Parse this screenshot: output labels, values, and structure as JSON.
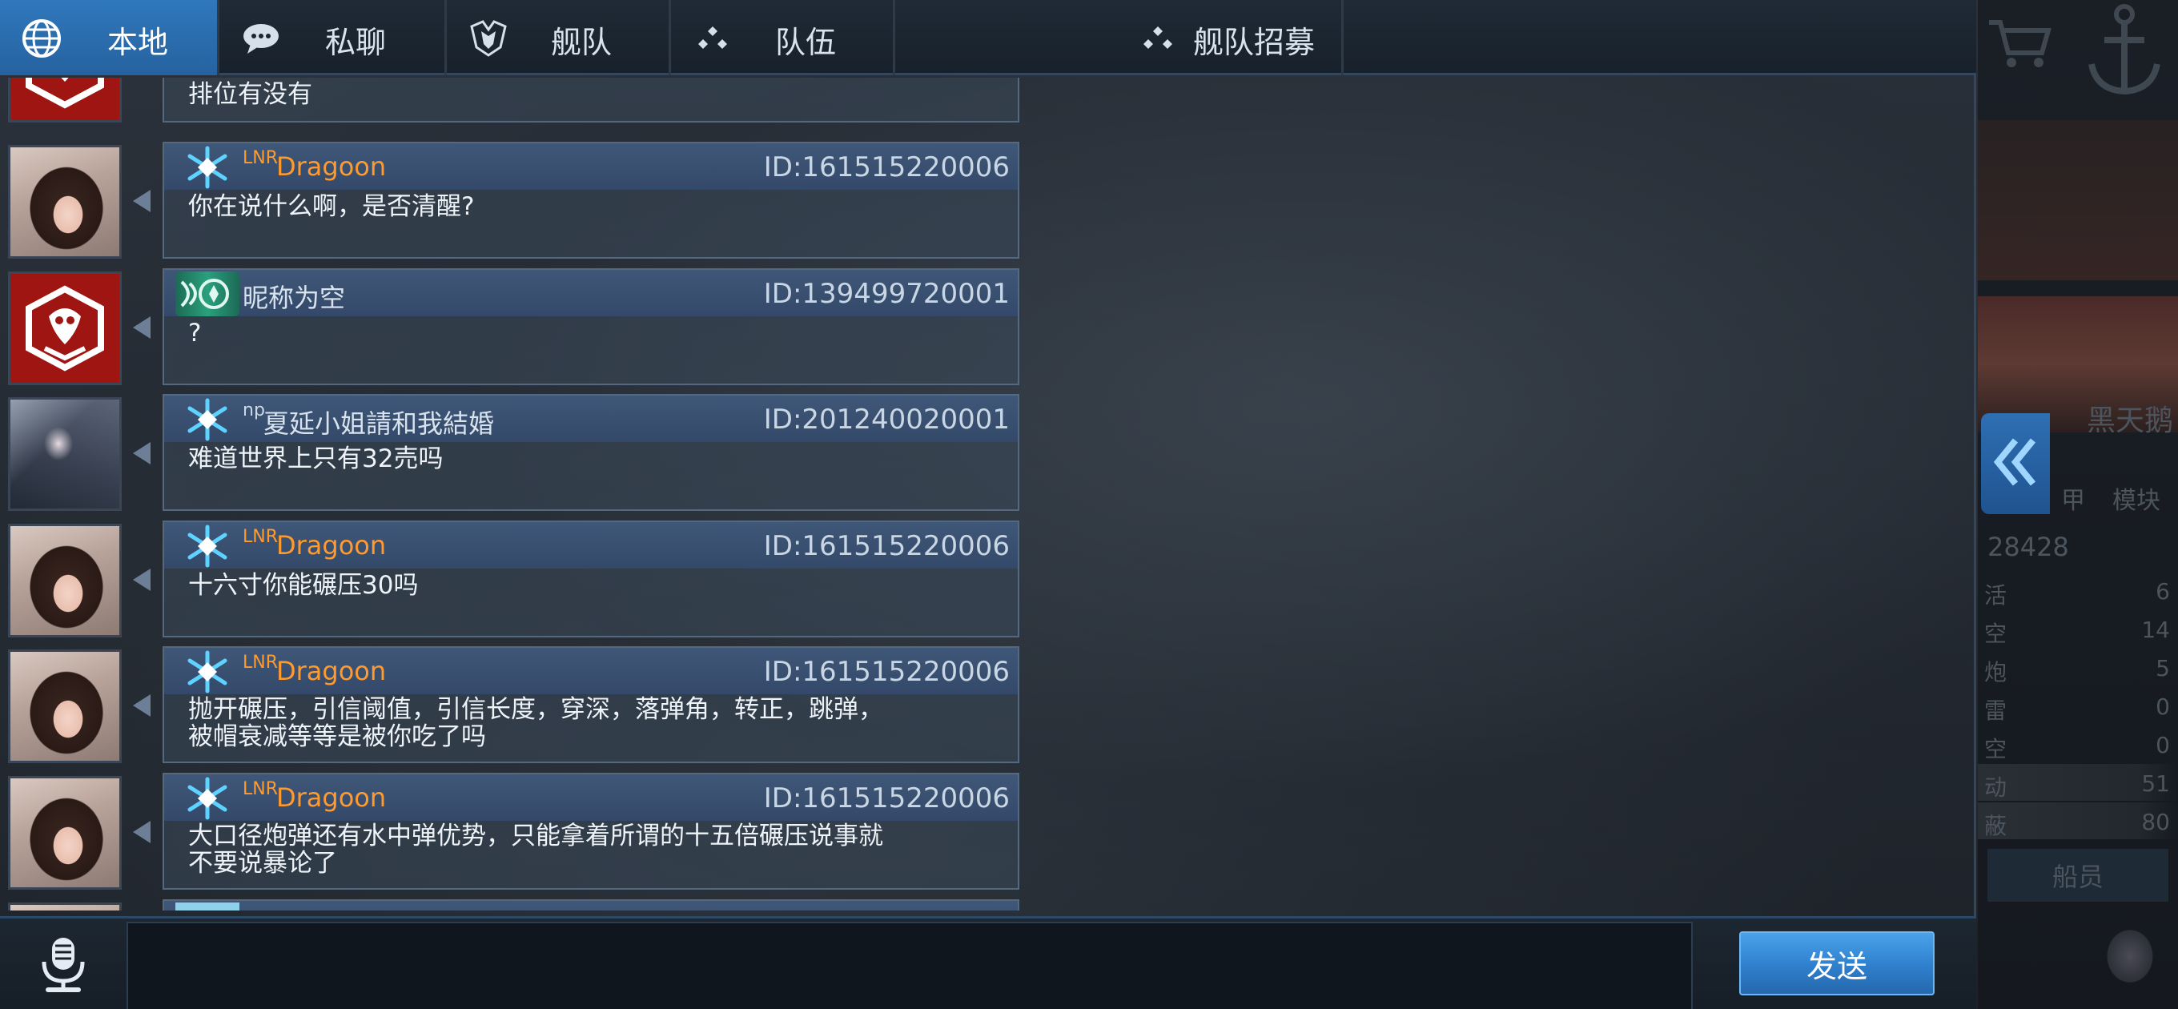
{
  "tabs": [
    {
      "label": "本地",
      "icon": "globe-icon",
      "active": true
    },
    {
      "label": "私聊",
      "icon": "chat-bubble-icon",
      "active": false
    },
    {
      "label": "舰队",
      "icon": "fleet-crest-icon",
      "active": false
    },
    {
      "label": "队伍",
      "icon": "team-dots-icon",
      "active": false
    },
    {
      "label": "舰队招募",
      "icon": "team-dots-icon",
      "active": false
    }
  ],
  "messages": [
    {
      "avatar": "red-emblem",
      "badge": "none",
      "prefix": "",
      "name": "",
      "id": "",
      "text": "排位有没有"
    },
    {
      "avatar": "girl",
      "badge": "blue-snowflake",
      "prefix": "LNR",
      "name": "Dragoon",
      "id": "ID:161515220006",
      "text": "你在说什么啊，是否清醒?"
    },
    {
      "avatar": "red-emblem",
      "badge": "green-dragon",
      "prefix": "",
      "name": "昵称为空",
      "id": "ID:139499720001",
      "text": "?"
    },
    {
      "avatar": "mecha",
      "badge": "blue-snowflake",
      "prefix": "np",
      "name": "夏延小姐請和我結婚",
      "id": "ID:201240020001",
      "text": "难道世界上只有32売吗"
    },
    {
      "avatar": "girl",
      "badge": "blue-snowflake",
      "prefix": "LNR",
      "name": "Dragoon",
      "id": "ID:161515220006",
      "text": "十六寸你能碾压30吗"
    },
    {
      "avatar": "girl",
      "badge": "blue-snowflake",
      "prefix": "LNR",
      "name": "Dragoon",
      "id": "ID:161515220006",
      "text": "抛开碾压，引信阈值，引信长度，穿深，落弹角，转正，跳弹，\n被帽衰减等等是被你吃了吗"
    },
    {
      "avatar": "girl",
      "badge": "blue-snowflake",
      "prefix": "LNR",
      "name": "Dragoon",
      "id": "ID:161515220006",
      "text": "大口径炮弹还有水中弹优势，只能拿着所谓的十五倍碾压说事就\n不要说暴论了"
    }
  ],
  "input": {
    "value": "",
    "placeholder": ""
  },
  "send_label": "发送",
  "side_panel": {
    "ship_name": "黑天鹅",
    "tab_labels": [
      "甲",
      "模块"
    ],
    "power": "28428",
    "stats": [
      {
        "label": "活",
        "value": "6"
      },
      {
        "label": "空",
        "value": "14"
      },
      {
        "label": "炮",
        "value": "5"
      },
      {
        "label": "雷",
        "value": "0"
      },
      {
        "label": "空",
        "value": "0"
      },
      {
        "label": "动",
        "value": "51"
      },
      {
        "label": "蔽",
        "value": "80"
      }
    ],
    "crew_label": "船员"
  },
  "colors": {
    "tab_active": "#2f78bc",
    "name_orange": "#ff9a2e",
    "bubble_header": "#3f5778",
    "send_button": "#3a8fdc",
    "emblem_red": "#9e1512"
  }
}
